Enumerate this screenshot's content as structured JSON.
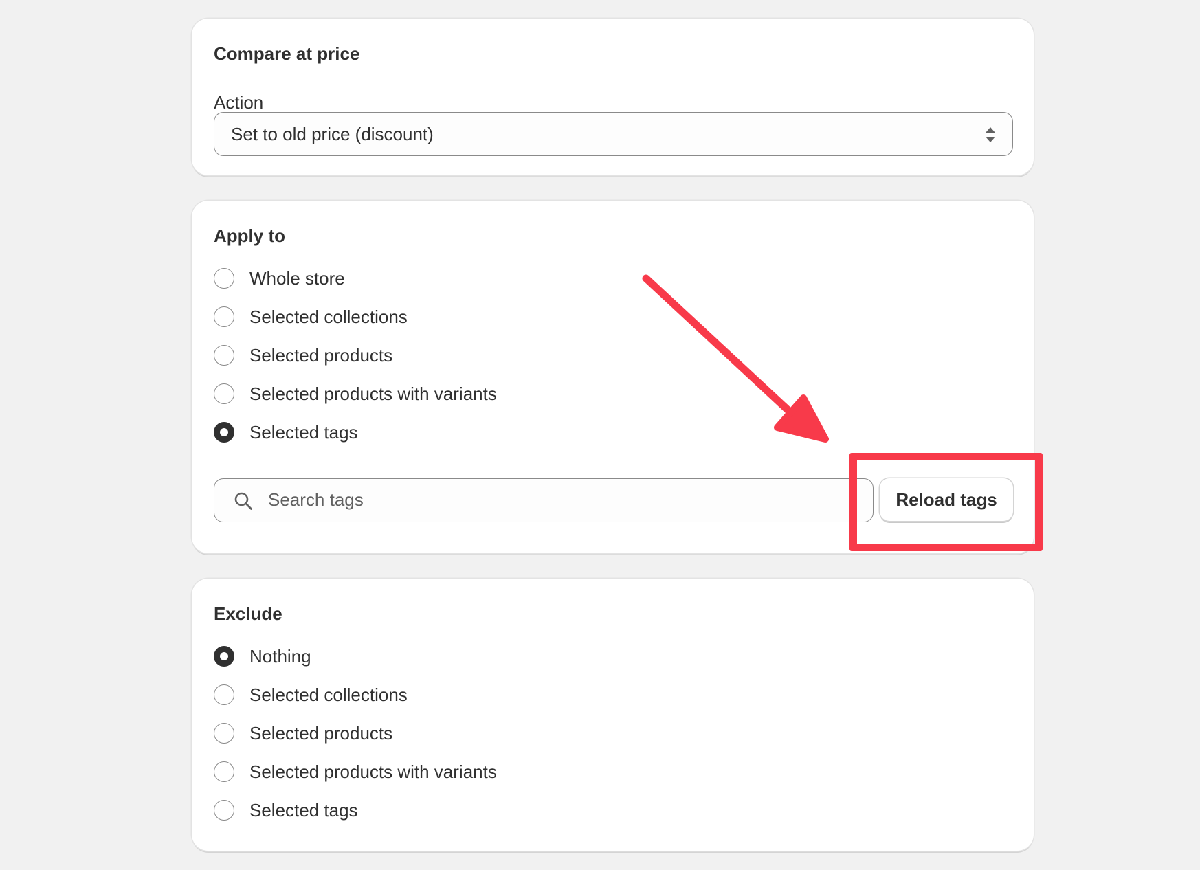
{
  "compare_card": {
    "title": "Compare at price",
    "action_label": "Action",
    "action_value": "Set to old price (discount)"
  },
  "apply_card": {
    "title": "Apply to",
    "options": [
      {
        "label": "Whole store",
        "checked": false
      },
      {
        "label": "Selected collections",
        "checked": false
      },
      {
        "label": "Selected products",
        "checked": false
      },
      {
        "label": "Selected products with variants",
        "checked": false
      },
      {
        "label": "Selected tags",
        "checked": true
      }
    ],
    "search_placeholder": "Search tags",
    "reload_label": "Reload tags"
  },
  "exclude_card": {
    "title": "Exclude",
    "options": [
      {
        "label": "Nothing",
        "checked": true
      },
      {
        "label": "Selected collections",
        "checked": false
      },
      {
        "label": "Selected products",
        "checked": false
      },
      {
        "label": "Selected products with variants",
        "checked": false
      },
      {
        "label": "Selected tags",
        "checked": false
      }
    ]
  },
  "icons": {
    "select": "select-arrows-icon",
    "search": "search-icon",
    "annotation": "arrow-icon"
  },
  "colors": {
    "annotation": "#f83a4a",
    "text": "#303030",
    "background": "#f1f1f1"
  }
}
